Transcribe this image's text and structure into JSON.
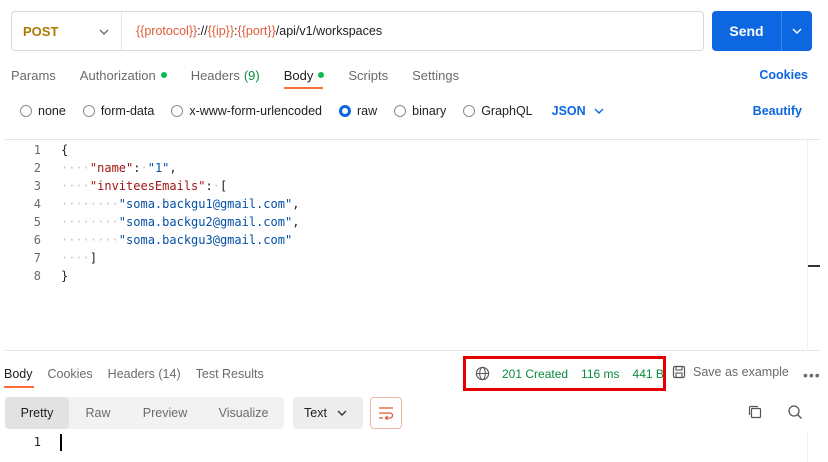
{
  "request": {
    "method": "POST",
    "url_parts": [
      {
        "text": "{{protocol}}",
        "var": true
      },
      {
        "text": "://",
        "var": false
      },
      {
        "text": "{{ip}}",
        "var": true
      },
      {
        "text": ":",
        "var": false
      },
      {
        "text": "{{port}}",
        "var": true
      },
      {
        "text": "/api/v1/workspaces",
        "var": false
      }
    ],
    "send_label": "Send"
  },
  "request_tabs": [
    {
      "label": "Params",
      "count": "",
      "dot": false,
      "active": false
    },
    {
      "label": "Authorization",
      "count": "",
      "dot": true,
      "active": false
    },
    {
      "label": "Headers",
      "count": "(9)",
      "dot": false,
      "active": false
    },
    {
      "label": "Body",
      "count": "",
      "dot": true,
      "active": true
    },
    {
      "label": "Scripts",
      "count": "",
      "dot": false,
      "active": false
    },
    {
      "label": "Settings",
      "count": "",
      "dot": false,
      "active": false
    }
  ],
  "cookies_label": "Cookies",
  "body_types": [
    {
      "label": "none",
      "checked": false
    },
    {
      "label": "form-data",
      "checked": false
    },
    {
      "label": "x-www-form-urlencoded",
      "checked": false
    },
    {
      "label": "raw",
      "checked": true
    },
    {
      "label": "binary",
      "checked": false
    },
    {
      "label": "GraphQL",
      "checked": false
    }
  ],
  "body_format": "JSON",
  "beautify_label": "Beautify",
  "code_lines": [
    {
      "n": "1",
      "tokens": [
        {
          "t": "{",
          "c": ""
        }
      ]
    },
    {
      "n": "2",
      "tokens": [
        {
          "t": "····",
          "c": "ws"
        },
        {
          "t": "\"name\"",
          "c": "key"
        },
        {
          "t": ":",
          "c": ""
        },
        {
          "t": "·",
          "c": "ws"
        },
        {
          "t": "\"1\"",
          "c": "str"
        },
        {
          "t": ",",
          "c": ""
        }
      ]
    },
    {
      "n": "3",
      "tokens": [
        {
          "t": "····",
          "c": "ws"
        },
        {
          "t": "\"inviteesEmails\"",
          "c": "key"
        },
        {
          "t": ":",
          "c": ""
        },
        {
          "t": "·",
          "c": "ws"
        },
        {
          "t": "[",
          "c": ""
        }
      ]
    },
    {
      "n": "4",
      "tokens": [
        {
          "t": "········",
          "c": "ws"
        },
        {
          "t": "\"soma.backgu1@gmail.com\"",
          "c": "str"
        },
        {
          "t": ",",
          "c": ""
        }
      ]
    },
    {
      "n": "5",
      "tokens": [
        {
          "t": "········",
          "c": "ws"
        },
        {
          "t": "\"soma.backgu2@gmail.com\"",
          "c": "str"
        },
        {
          "t": ",",
          "c": ""
        }
      ]
    },
    {
      "n": "6",
      "tokens": [
        {
          "t": "········",
          "c": "ws"
        },
        {
          "t": "\"soma.backgu3@gmail.com\"",
          "c": "str"
        }
      ]
    },
    {
      "n": "7",
      "tokens": [
        {
          "t": "····",
          "c": "ws"
        },
        {
          "t": "]",
          "c": ""
        }
      ]
    },
    {
      "n": "8",
      "tokens": [
        {
          "t": "}",
          "c": ""
        }
      ]
    }
  ],
  "response_tabs": [
    {
      "label": "Body",
      "count": "",
      "active": true
    },
    {
      "label": "Cookies",
      "count": "",
      "active": false
    },
    {
      "label": "Headers",
      "count": "(14)",
      "active": false
    },
    {
      "label": "Test Results",
      "count": "",
      "active": false
    }
  ],
  "response_meta": {
    "status": "201 Created",
    "time": "116 ms",
    "size": "441 B"
  },
  "save_example_label": "Save as example",
  "view_tabs": [
    {
      "label": "Pretty",
      "active": true
    },
    {
      "label": "Raw",
      "active": false
    },
    {
      "label": "Preview",
      "active": false
    },
    {
      "label": "Visualize",
      "active": false
    }
  ],
  "view_format": "Text",
  "response_body_lines": [
    "1"
  ],
  "colors": {
    "accent": "#0c67e0",
    "method": "#ad7a03",
    "success": "#0a8a3e",
    "tab_underline": "#ff6c37",
    "highlight": "#e60000"
  }
}
